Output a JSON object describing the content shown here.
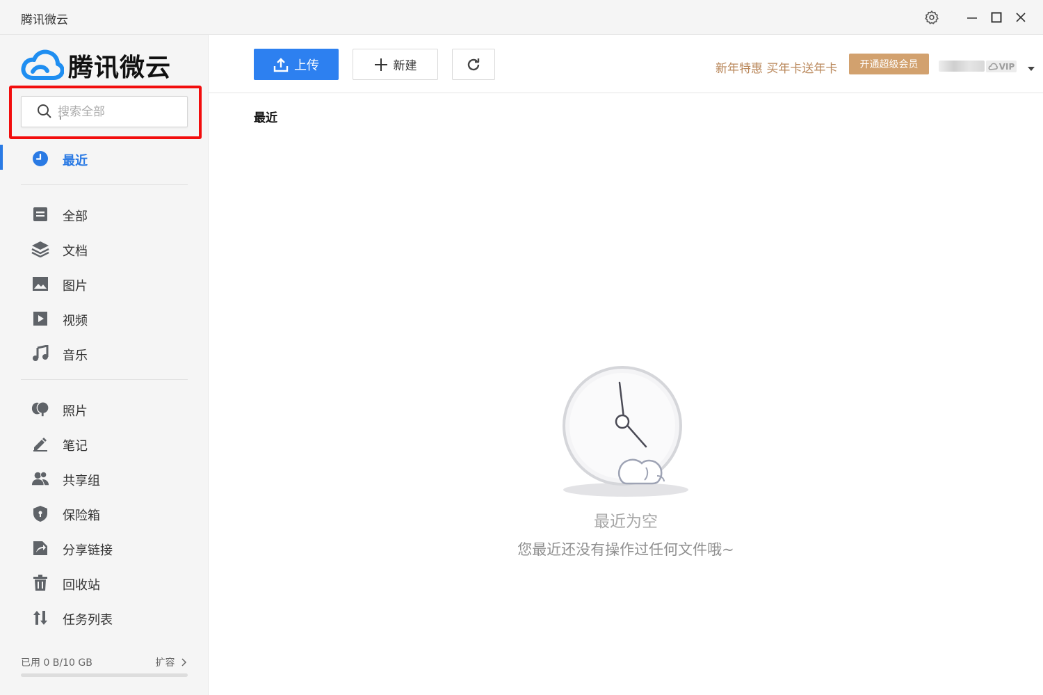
{
  "window": {
    "title": "腾讯微云"
  },
  "brand": {
    "logo_text": "腾讯微云",
    "accent": "#2a7ae4"
  },
  "search": {
    "placeholder": "搜索全部",
    "value": ""
  },
  "sidebar": {
    "active": {
      "label": "最近",
      "icon": "clock-icon"
    },
    "group1": [
      {
        "label": "全部",
        "icon": "file-all-icon"
      },
      {
        "label": "文档",
        "icon": "layers-icon"
      },
      {
        "label": "图片",
        "icon": "image-icon"
      },
      {
        "label": "视频",
        "icon": "video-icon"
      },
      {
        "label": "音乐",
        "icon": "music-icon"
      }
    ],
    "group2": [
      {
        "label": "照片",
        "icon": "photo-icon"
      },
      {
        "label": "笔记",
        "icon": "pen-icon"
      },
      {
        "label": "共享组",
        "icon": "users-icon"
      },
      {
        "label": "保险箱",
        "icon": "shield-icon"
      },
      {
        "label": "分享链接",
        "icon": "share-icon"
      },
      {
        "label": "回收站",
        "icon": "trash-icon"
      },
      {
        "label": "任务列表",
        "icon": "transfer-icon"
      }
    ],
    "storage": {
      "used_text": "已用 0 B/10 GB",
      "expand_label": "扩容",
      "used_fraction": 0
    }
  },
  "toolbar": {
    "upload_label": "上传",
    "new_label": "新建",
    "promo_text": "新年特惠 买年卡送年卡",
    "vip_button_label": "开通超级会员",
    "vip_badge": "VIP"
  },
  "main": {
    "section_title": "最近",
    "empty_title": "最近为空",
    "empty_subtitle": "您最近还没有操作过任何文件哦~"
  }
}
